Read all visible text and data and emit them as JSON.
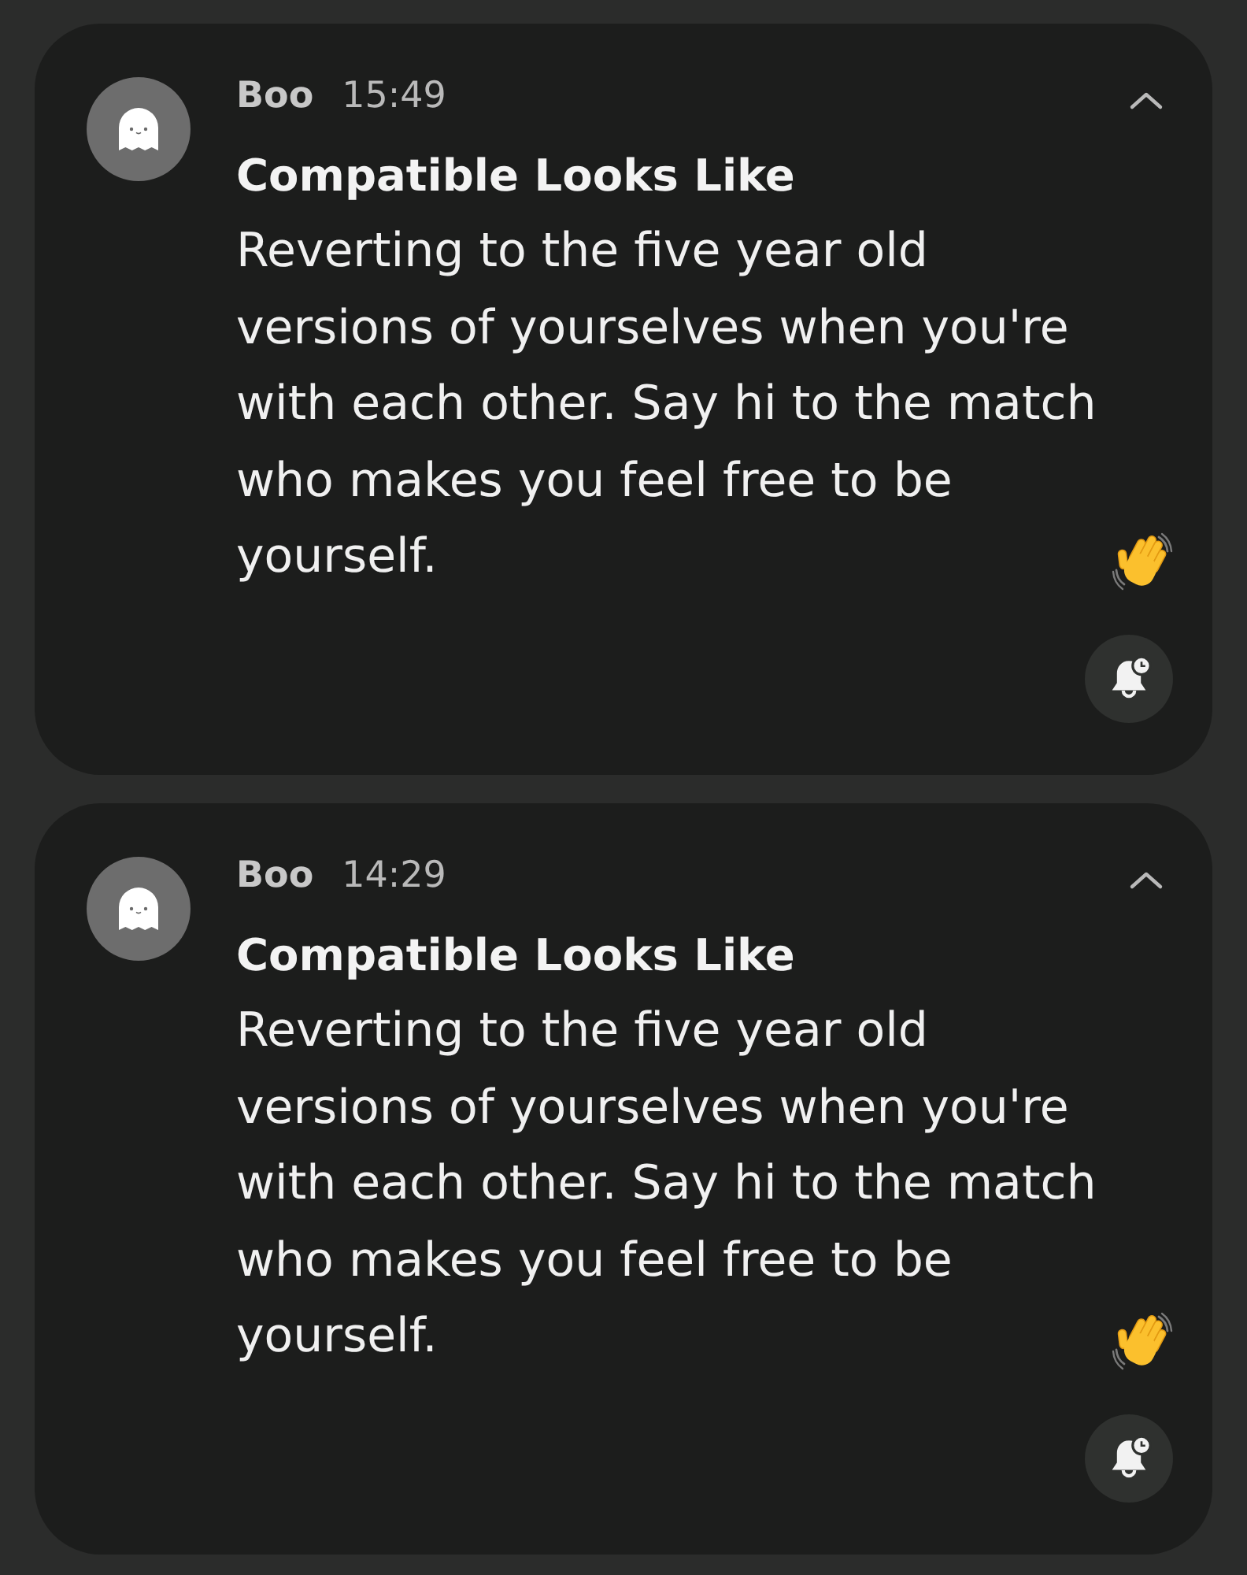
{
  "notifications": [
    {
      "app": "Boo",
      "time": "15:49",
      "title": "Compatible Looks Like",
      "body": "Reverting to the five year old versions of yourselves when you're with each other. Say hi to the match who makes you feel free to be yourself.",
      "expanded": true
    },
    {
      "app": "Boo",
      "time": "14:29",
      "title": "Compatible Looks Like",
      "body": "Reverting to the five year old versions of yourselves when you're with each other. Say hi to the match who makes you feel free to be yourself.",
      "expanded": true
    }
  ]
}
